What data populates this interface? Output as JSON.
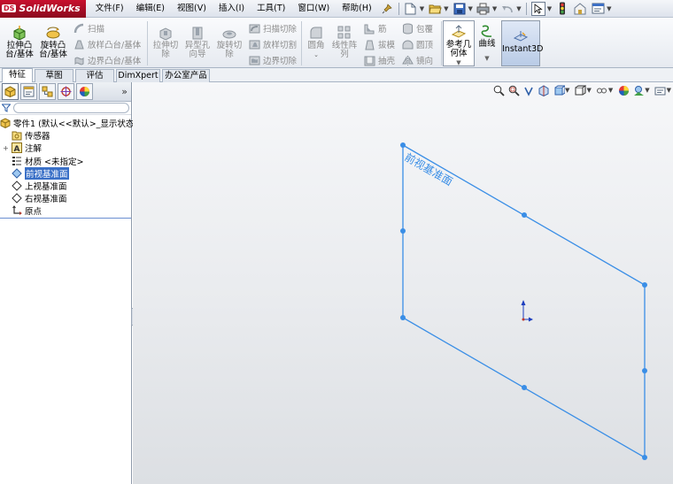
{
  "app": {
    "logo_prefix": "DS",
    "logo_text": "SolidWorks"
  },
  "menu": [
    {
      "label": "文件(F)"
    },
    {
      "label": "编辑(E)"
    },
    {
      "label": "视图(V)"
    },
    {
      "label": "插入(I)"
    },
    {
      "label": "工具(T)"
    },
    {
      "label": "窗口(W)"
    },
    {
      "label": "帮助(H)"
    }
  ],
  "command_manager": {
    "extrude_boss": "拉伸凸\n台/基体",
    "revolve_boss": "旋转凸\n台/基体",
    "sweep": "扫描",
    "loft": "放样凸台/基体",
    "boundary_boss": "边界凸台/基体",
    "extrude_cut": "拉伸切\n除",
    "hole_wizard": "异型孔\n向导",
    "revolve_cut": "旋转切\n除",
    "sweep_cut": "扫描切除",
    "loft_cut": "放样切割",
    "boundary_cut": "边界切除",
    "fillet": "圆角",
    "linear_pattern": "线性阵\n列",
    "rib": "筋",
    "draft": "拔模",
    "shell": "抽壳",
    "wrap": "包覆",
    "dome": "圆顶",
    "mirror": "镜向",
    "ref_geometry": "参考几\n何体",
    "curves": "曲线",
    "instant3d": "Instant3D"
  },
  "cmd_tabs": [
    {
      "label": "特征",
      "active": true
    },
    {
      "label": "草图",
      "active": false
    },
    {
      "label": "评估",
      "active": false
    },
    {
      "label": "DimXpert",
      "active": false
    },
    {
      "label": "办公室产品",
      "active": false
    }
  ],
  "panel": {
    "expand_glyph": "»"
  },
  "tree": [
    {
      "label": "零件1 (默认<<默认>_显示状态",
      "icon": "part-icon",
      "expander": ""
    },
    {
      "label": "传感器",
      "icon": "sensor-folder-icon",
      "expander": ""
    },
    {
      "label": "注解",
      "icon": "annotation-icon",
      "expander": "+"
    },
    {
      "label": "材质 <未指定>",
      "icon": "material-icon",
      "expander": ""
    },
    {
      "label": "前视基准面",
      "icon": "plane-icon",
      "expander": "",
      "selected": true
    },
    {
      "label": "上视基准面",
      "icon": "plane-icon",
      "expander": ""
    },
    {
      "label": "右视基准面",
      "icon": "plane-icon",
      "expander": ""
    },
    {
      "label": "原点",
      "icon": "origin-icon",
      "expander": ""
    }
  ],
  "graphics": {
    "plane_label": "前视基准面",
    "plane_color": "#3a8ee6"
  }
}
